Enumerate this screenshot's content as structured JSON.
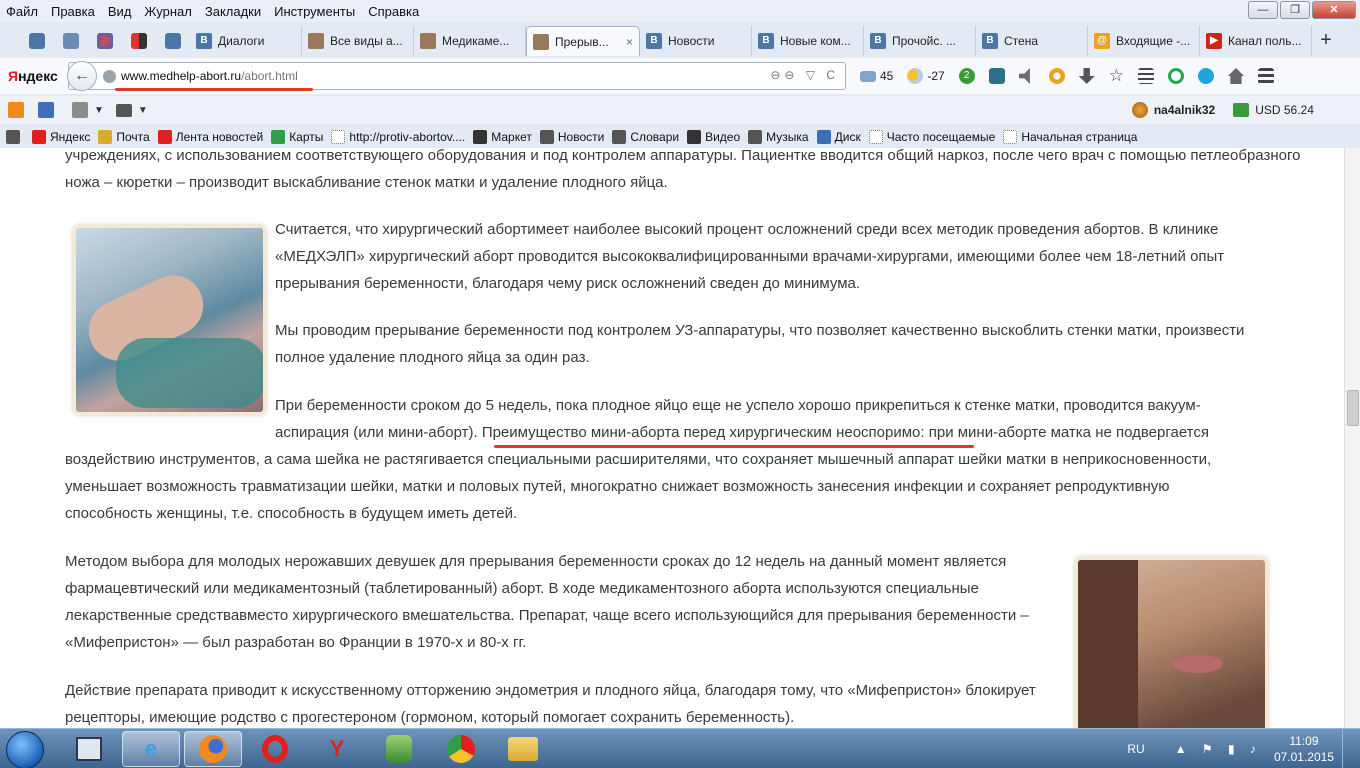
{
  "menu": [
    "Файл",
    "Правка",
    "Вид",
    "Журнал",
    "Закладки",
    "Инструменты",
    "Справка"
  ],
  "window_controls": {
    "minimize": "—",
    "maximize": "❐",
    "close": "✕"
  },
  "tabs": [
    {
      "label": "Диалоги",
      "color": "#4a76a8",
      "glyph": "В"
    },
    {
      "label": "Все виды а...",
      "color": "#9a7a5a",
      "glyph": ""
    },
    {
      "label": "Медикаме...",
      "color": "#9a7a5a",
      "glyph": ""
    },
    {
      "label": "Прерыв...",
      "color": "#9a7a5a",
      "glyph": "",
      "active": true
    },
    {
      "label": "Новости",
      "color": "#4a76a8",
      "glyph": "В"
    },
    {
      "label": "Новые ком...",
      "color": "#4a76a8",
      "glyph": "В"
    },
    {
      "label": "Прочойс. ...",
      "color": "#4a76a8",
      "glyph": "В"
    },
    {
      "label": "Стена",
      "color": "#4a76a8",
      "glyph": "В"
    },
    {
      "label": "Входящие -...",
      "color": "#e8a320",
      "glyph": "@"
    },
    {
      "label": "Канал поль...",
      "color": "#d3221b",
      "glyph": "▶"
    }
  ],
  "tab_close": "×",
  "new_tab": "+",
  "browser": {
    "logo_y": "Я",
    "logo_rest": "ндекс",
    "url_domain": "www.medhelp-abort.ru",
    "url_path": "/abort.html",
    "url_icons": "⊖⊖ ▽ C",
    "back": "←"
  },
  "nav_widgets": {
    "mail_count": "45",
    "weather": "-27",
    "badge": "2"
  },
  "ext": {
    "user": "na4alnik32",
    "usd": "USD 56.24"
  },
  "bookmarks": [
    "Яндекс",
    "Почта",
    "Лента новостей",
    "Карты",
    "http://protiv-abortov....",
    "Маркет",
    "Новости",
    "Словари",
    "Видео",
    "Музыка",
    "Диск",
    "Часто посещаемые",
    "Начальная страница"
  ],
  "article": {
    "p0": "учреждениях, с использованием соответствующего оборудования и под контролем аппаратуры. Пациентке вводится общий наркоз, после чего врач с помощью петлеобразного ножа – кюретки – производит выскабливание стенок матки и удаление плодного яйца.",
    "p1": "Считается, что хирургический абортимеет наиболее высокий процент осложнений среди всех методик проведения абортов. В клинике «МЕДХЭЛП» хирургический аборт проводится высококвалифицированными врачами-хирургами, имеющими более чем 18-летний опыт прерывания беременности, благодаря чему риск осложнений сведен до минимума.",
    "p2": "Мы проводим прерывание беременности под контролем УЗ-аппаратуры, что позволяет качественно выскоблить стенки матки, произвести полное удаление плодного яйца за один раз.",
    "p3a": "При беременности сроком до 5 недель, пока плодное яйцо еще не успело хорошо прикрепиться к стенке матки, проводится вакуум-",
    "p3b": "аспирация (или мини-аборт). ",
    "p3c": "Преимущество мини-аборта перед хирургическим неоспоримо:",
    "p3d": " при мини-аборте матка не подвергается",
    "p3e": "воздействию инструментов, а сама шейка не растягивается специальными расширителями, что сохраняет мышечный аппарат шейки матки в неприкосновенности, уменьшает возможность травматизации шейки, матки и половых путей, многократно снижает возможность занесения инфекции и сохраняет репродуктивную способность женщины, т.е. способность в будущем иметь детей.",
    "p4": "Методом выбора для молодых нерожавших девушек для прерывания беременности сроках до 12 недель на данный момент является фармацевтический или медикаментозный (таблетированный) аборт. В ходе медикаментозного аборта используются специальные лекарственные средствавместо хирургического вмешательства. Препарат, чаще всего использующийся для прерывания беременности – «Мифепристон» — был разработан во Франции в 1970-х и 80-х гг.",
    "p5": "Действие препарата приводит к искусственному отторжению эндометрия и плодного яйца, благодаря тому, что «Мифепристон» блокирует рецепторы, имеющие родство с прогестероном (гормоном, который помогает сохранить беременность)."
  },
  "tray": {
    "lang": "RU",
    "time": "11:09",
    "date": "07.01.2015"
  }
}
